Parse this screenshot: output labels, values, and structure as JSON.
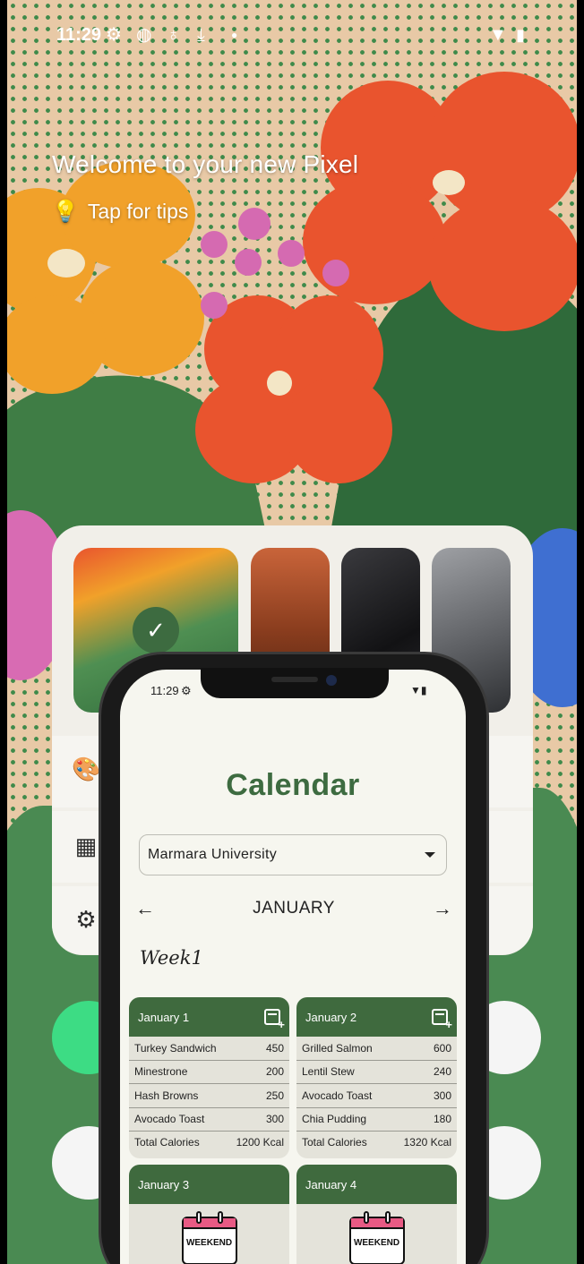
{
  "status_bar": {
    "time": "11:29",
    "icons": [
      "settings-icon",
      "shield-icon",
      "lightbulb-icon",
      "download-icon",
      "dot-icon"
    ],
    "right_icons": [
      "wifi-icon",
      "battery-icon"
    ]
  },
  "home": {
    "welcome": "Welcome to your new Pixel",
    "tips": "Tap for tips"
  },
  "picker": {
    "selected_index": 0,
    "rows": [
      "palette-icon",
      "widgets-icon",
      "settings-icon"
    ]
  },
  "phone": {
    "status_time": "11:29",
    "title": "Calendar",
    "university": "Marmara University",
    "month": "JANUARY",
    "week": "Week1",
    "days": [
      {
        "label": "January 1",
        "meals": [
          {
            "name": "Turkey Sandwich",
            "kcal": "450"
          },
          {
            "name": "Minestrone",
            "kcal": "200"
          },
          {
            "name": "Hash Browns",
            "kcal": "250"
          },
          {
            "name": "Avocado Toast",
            "kcal": "300"
          }
        ],
        "total_label": "Total Calories",
        "total": "1200 Kcal"
      },
      {
        "label": "January 2",
        "meals": [
          {
            "name": "Grilled Salmon",
            "kcal": "600"
          },
          {
            "name": "Lentil Stew",
            "kcal": "240"
          },
          {
            "name": "Avocado Toast",
            "kcal": "300"
          },
          {
            "name": "Chia Pudding",
            "kcal": "180"
          }
        ],
        "total_label": "Total Calories",
        "total": "1320 Kcal"
      },
      {
        "label": "January 3",
        "weekend": "WEEKEND"
      },
      {
        "label": "January 4",
        "weekend": "WEEKEND"
      }
    ]
  },
  "colors": {
    "accent_green": "#3f6a3e",
    "title_green": "#3d6b40",
    "weekend_pink": "#e85a84"
  }
}
